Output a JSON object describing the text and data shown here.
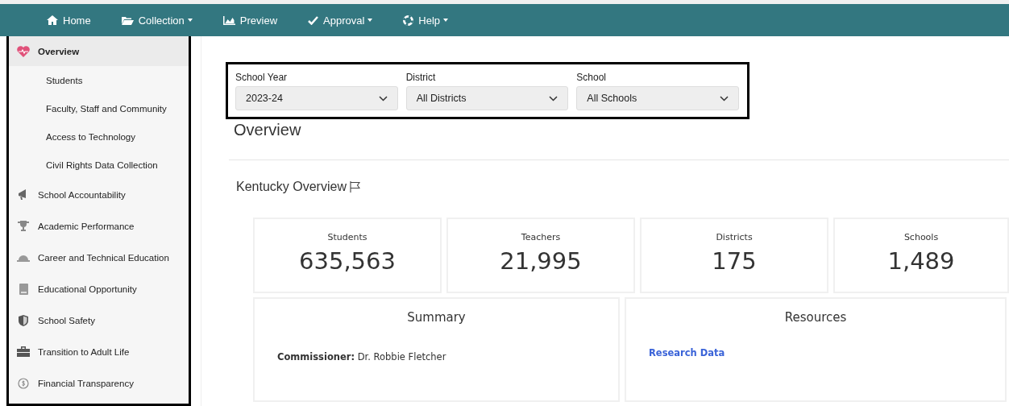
{
  "navbar": {
    "items": [
      {
        "label": "Home",
        "dropdown": false
      },
      {
        "label": "Collection",
        "dropdown": true
      },
      {
        "label": "Preview",
        "dropdown": false
      },
      {
        "label": "Approval",
        "dropdown": true
      },
      {
        "label": "Help",
        "dropdown": true
      }
    ]
  },
  "sidebar": {
    "items": [
      {
        "label": "Overview",
        "selected": true,
        "children": [
          {
            "label": "Students",
            "selected": false
          },
          {
            "label": "Faculty, Staff and Community",
            "selected": false
          },
          {
            "label": "Access to Technology",
            "selected": false
          },
          {
            "label": "Civil Rights Data Collection",
            "selected": false
          }
        ]
      },
      {
        "label": "School Accountability",
        "selected": false
      },
      {
        "label": "Academic Performance",
        "selected": false
      },
      {
        "label": "Career and Technical Education",
        "selected": false
      },
      {
        "label": "Educational Opportunity",
        "selected": false
      },
      {
        "label": "School Safety",
        "selected": false
      },
      {
        "label": "Transition to Adult Life",
        "selected": false
      },
      {
        "label": "Financial Transparency",
        "selected": false
      }
    ]
  },
  "filters": [
    {
      "label": "School Year",
      "value": "2023-24"
    },
    {
      "label": "District",
      "value": "All Districts"
    },
    {
      "label": "School",
      "value": "All Schools"
    }
  ],
  "page_title": "Overview",
  "section_title": "Kentucky Overview",
  "stats": [
    {
      "label": "Students",
      "value": "635,563"
    },
    {
      "label": "Teachers",
      "value": "21,995"
    },
    {
      "label": "Districts",
      "value": "175"
    },
    {
      "label": "Schools",
      "value": "1,489"
    }
  ],
  "summary": {
    "title": "Summary",
    "lines": [
      "**Commissioner:** Dr. Robbie Fletcher"
    ]
  },
  "resources": {
    "title": "Resources",
    "links": [
      "Research Data"
    ]
  }
}
